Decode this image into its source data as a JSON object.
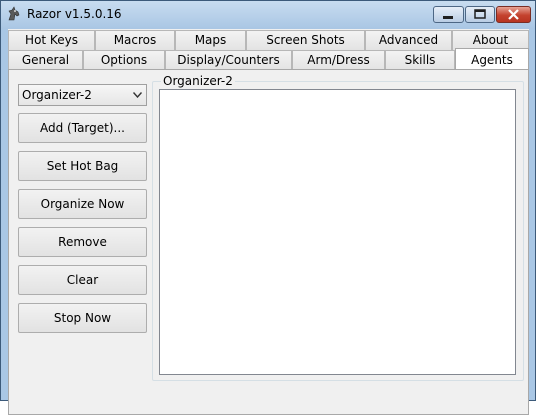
{
  "window": {
    "title": "Razor v1.5.0.16"
  },
  "tabs_row_top": [
    "Hot Keys",
    "Macros",
    "Maps",
    "Screen Shots",
    "Advanced",
    "About"
  ],
  "tabs_row_bottom": [
    "General",
    "Options",
    "Display/Counters",
    "Arm/Dress",
    "Skills",
    "Agents"
  ],
  "active_tab": "Agents",
  "agents": {
    "selected_agent": "Organizer-2",
    "buttons": {
      "add_target": "Add (Target)...",
      "set_hot_bag": "Set Hot Bag",
      "organize_now": "Organize Now",
      "remove": "Remove",
      "clear": "Clear",
      "stop_now": "Stop Now"
    },
    "group_title": "Organizer-2",
    "items": []
  },
  "icons": {
    "app": "horse-head-icon",
    "minimize": "minimize-icon",
    "maximize": "maximize-icon",
    "close": "close-icon"
  }
}
